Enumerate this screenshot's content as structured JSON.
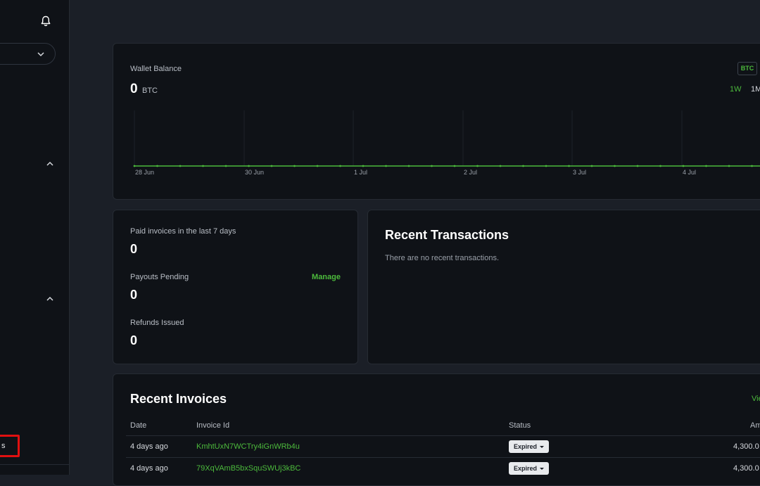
{
  "sidebar": {
    "highlighted_item_label": "s"
  },
  "wallet_balance": {
    "label": "Wallet Balance",
    "value": "0",
    "unit": "BTC",
    "currency_toggle": "BTC",
    "ranges": [
      "1W",
      "1M"
    ],
    "active_range": "1W"
  },
  "chart_data": {
    "type": "line",
    "x_ticks": [
      "28 Jun",
      "30 Jun",
      "1 Jul",
      "2 Jul",
      "3 Jul",
      "4 Jul"
    ],
    "x": [
      "27 Jun",
      "27 Jun",
      "28 Jun",
      "28 Jun",
      "29 Jun",
      "29 Jun",
      "30 Jun",
      "30 Jun",
      "30 Jun",
      "1 Jul",
      "1 Jul",
      "1 Jul",
      "1 Jul",
      "2 Jul",
      "2 Jul",
      "2 Jul",
      "2 Jul",
      "3 Jul",
      "3 Jul",
      "3 Jul",
      "3 Jul",
      "4 Jul",
      "4 Jul",
      "4 Jul",
      "4 Jul",
      "4 Jul",
      "5 Jul",
      "5 Jul",
      "5 Jul"
    ],
    "values": [
      0,
      0,
      0,
      0,
      0,
      0,
      0,
      0,
      0,
      0,
      0,
      0,
      0,
      0,
      0,
      0,
      0,
      0,
      0,
      0,
      0,
      0,
      0,
      0,
      0,
      0,
      0,
      0,
      0
    ],
    "line_color": "#4cba3c",
    "grid": true
  },
  "stats": {
    "paid_label": "Paid invoices in the last 7 days",
    "paid_value": "0",
    "payouts_label": "Payouts Pending",
    "payouts_value": "0",
    "manage_label": "Manage",
    "refunds_label": "Refunds Issued",
    "refunds_value": "0"
  },
  "transactions": {
    "title": "Recent Transactions",
    "empty_text": "There are no recent transactions."
  },
  "invoices": {
    "title": "Recent Invoices",
    "view_all": "Vie",
    "columns": {
      "date": "Date",
      "id": "Invoice Id",
      "status": "Status",
      "amount": "Am"
    },
    "rows": [
      {
        "date": "4 days ago",
        "id": "KmhtUxN7WCTry4iGnWRb4u",
        "status": "Expired",
        "amount": "4,300.0"
      },
      {
        "date": "4 days ago",
        "id": "79XqVAmB5bxSquSWUj3kBC",
        "status": "Expired",
        "amount": "4,300.0"
      }
    ]
  },
  "colors": {
    "accent": "#4cba3c",
    "highlight": "#e01010",
    "background": "#1b1f27",
    "card": "#0f1217"
  }
}
